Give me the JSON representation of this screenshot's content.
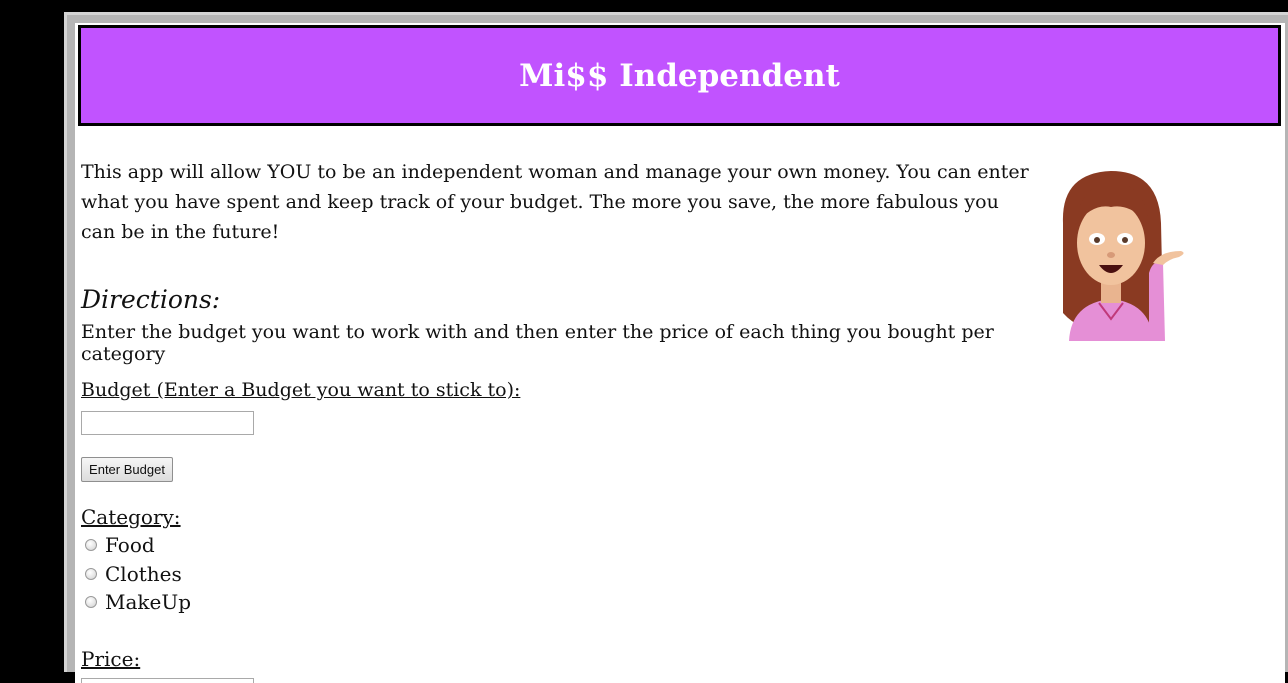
{
  "header": {
    "title": "Mi$$ Independent"
  },
  "intro": {
    "text": "This app will allow YOU to be an independent woman and manage your own money. You can enter what you have spent and keep track of your budget. The more you save, the more fabulous you can be in the future!"
  },
  "directions": {
    "heading": "Directions:",
    "text": "Enter the budget you want to work with and then enter the price of each thing you bought per category"
  },
  "budget": {
    "label": "Budget (Enter a Budget you want to stick to):",
    "value": "",
    "button_label": "Enter Budget"
  },
  "category": {
    "label": "Category:",
    "options": [
      "Food",
      "Clothes",
      "MakeUp"
    ]
  },
  "price": {
    "label": "Price:",
    "value": ""
  },
  "icons": {
    "mascot": "information-desk-person-emoji",
    "radio": "radio-button-icon"
  },
  "colors": {
    "header_bg": "#c153ff",
    "header_text": "#ffffff",
    "frame": "#000000"
  }
}
